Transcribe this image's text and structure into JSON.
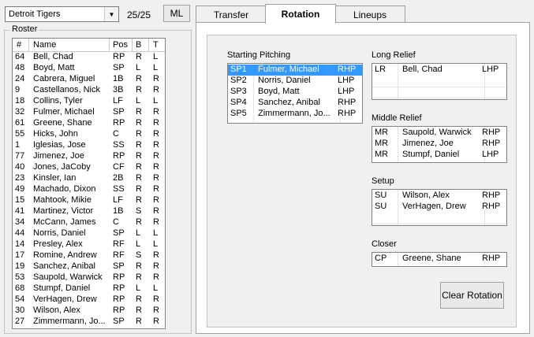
{
  "team_select": {
    "value": "Detroit Tigers"
  },
  "roster_count": "25/25",
  "ml_label": "ML",
  "tabs": [
    {
      "label": "Transfer",
      "active": false
    },
    {
      "label": "Rotation",
      "active": true
    },
    {
      "label": "Lineups",
      "active": false
    }
  ],
  "roster": {
    "legend": "Roster",
    "headers": {
      "num": "#",
      "name": "Name",
      "pos": "Pos",
      "b": "B",
      "t": "T"
    },
    "rows": [
      {
        "num": "64",
        "name": "Bell, Chad",
        "pos": "RP",
        "b": "R",
        "t": "L"
      },
      {
        "num": "48",
        "name": "Boyd, Matt",
        "pos": "SP",
        "b": "L",
        "t": "L"
      },
      {
        "num": "24",
        "name": "Cabrera, Miguel",
        "pos": "1B",
        "b": "R",
        "t": "R"
      },
      {
        "num": "9",
        "name": "Castellanos, Nick",
        "pos": "3B",
        "b": "R",
        "t": "R"
      },
      {
        "num": "18",
        "name": "Collins, Tyler",
        "pos": "LF",
        "b": "L",
        "t": "L"
      },
      {
        "num": "32",
        "name": "Fulmer, Michael",
        "pos": "SP",
        "b": "R",
        "t": "R"
      },
      {
        "num": "61",
        "name": "Greene, Shane",
        "pos": "RP",
        "b": "R",
        "t": "R"
      },
      {
        "num": "55",
        "name": "Hicks, John",
        "pos": "C",
        "b": "R",
        "t": "R"
      },
      {
        "num": "1",
        "name": "Iglesias, Jose",
        "pos": "SS",
        "b": "R",
        "t": "R"
      },
      {
        "num": "77",
        "name": "Jimenez, Joe",
        "pos": "RP",
        "b": "R",
        "t": "R"
      },
      {
        "num": "40",
        "name": "Jones, JaCoby",
        "pos": "CF",
        "b": "R",
        "t": "R"
      },
      {
        "num": "23",
        "name": "Kinsler, Ian",
        "pos": "2B",
        "b": "R",
        "t": "R"
      },
      {
        "num": "49",
        "name": "Machado, Dixon",
        "pos": "SS",
        "b": "R",
        "t": "R"
      },
      {
        "num": "15",
        "name": "Mahtook, Mikie",
        "pos": "LF",
        "b": "R",
        "t": "R"
      },
      {
        "num": "41",
        "name": "Martinez, Victor",
        "pos": "1B",
        "b": "S",
        "t": "R"
      },
      {
        "num": "34",
        "name": "McCann, James",
        "pos": "C",
        "b": "R",
        "t": "R"
      },
      {
        "num": "44",
        "name": "Norris, Daniel",
        "pos": "SP",
        "b": "L",
        "t": "L"
      },
      {
        "num": "14",
        "name": "Presley, Alex",
        "pos": "RF",
        "b": "L",
        "t": "L"
      },
      {
        "num": "17",
        "name": "Romine, Andrew",
        "pos": "RF",
        "b": "S",
        "t": "R"
      },
      {
        "num": "19",
        "name": "Sanchez, Anibal",
        "pos": "SP",
        "b": "R",
        "t": "R"
      },
      {
        "num": "53",
        "name": "Saupold, Warwick",
        "pos": "RP",
        "b": "R",
        "t": "R"
      },
      {
        "num": "68",
        "name": "Stumpf, Daniel",
        "pos": "RP",
        "b": "L",
        "t": "L"
      },
      {
        "num": "54",
        "name": "VerHagen, Drew",
        "pos": "RP",
        "b": "R",
        "t": "R"
      },
      {
        "num": "30",
        "name": "Wilson, Alex",
        "pos": "RP",
        "b": "R",
        "t": "R"
      },
      {
        "num": "27",
        "name": "Zimmermann, Jo...",
        "pos": "SP",
        "b": "R",
        "t": "R"
      }
    ]
  },
  "starting_pitching": {
    "label": "Starting Pitching",
    "rows": [
      {
        "slot": "SP1",
        "name": "Fulmer, Michael",
        "hand": "RHP",
        "selected": true
      },
      {
        "slot": "SP2",
        "name": "Norris, Daniel",
        "hand": "LHP"
      },
      {
        "slot": "SP3",
        "name": "Boyd, Matt",
        "hand": "LHP"
      },
      {
        "slot": "SP4",
        "name": "Sanchez, Anibal",
        "hand": "RHP"
      },
      {
        "slot": "SP5",
        "name": "Zimmermann, Jo...",
        "hand": "RHP"
      }
    ]
  },
  "long_relief": {
    "label": "Long Relief",
    "rows": [
      {
        "slot": "LR",
        "name": "Bell, Chad",
        "hand": "LHP"
      }
    ]
  },
  "middle_relief": {
    "label": "Middle Relief",
    "rows": [
      {
        "slot": "MR",
        "name": "Saupold, Warwick",
        "hand": "RHP"
      },
      {
        "slot": "MR",
        "name": "Jimenez, Joe",
        "hand": "RHP"
      },
      {
        "slot": "MR",
        "name": "Stumpf, Daniel",
        "hand": "LHP"
      }
    ]
  },
  "setup": {
    "label": "Setup",
    "rows": [
      {
        "slot": "SU",
        "name": "Wilson, Alex",
        "hand": "RHP"
      },
      {
        "slot": "SU",
        "name": "VerHagen, Drew",
        "hand": "RHP"
      }
    ]
  },
  "closer": {
    "label": "Closer",
    "rows": [
      {
        "slot": "CP",
        "name": "Greene, Shane",
        "hand": "RHP"
      }
    ]
  },
  "clear_button": "Clear Rotation",
  "colors": {
    "selection": "#3399ff",
    "window_bg": "#f0f0f0"
  }
}
